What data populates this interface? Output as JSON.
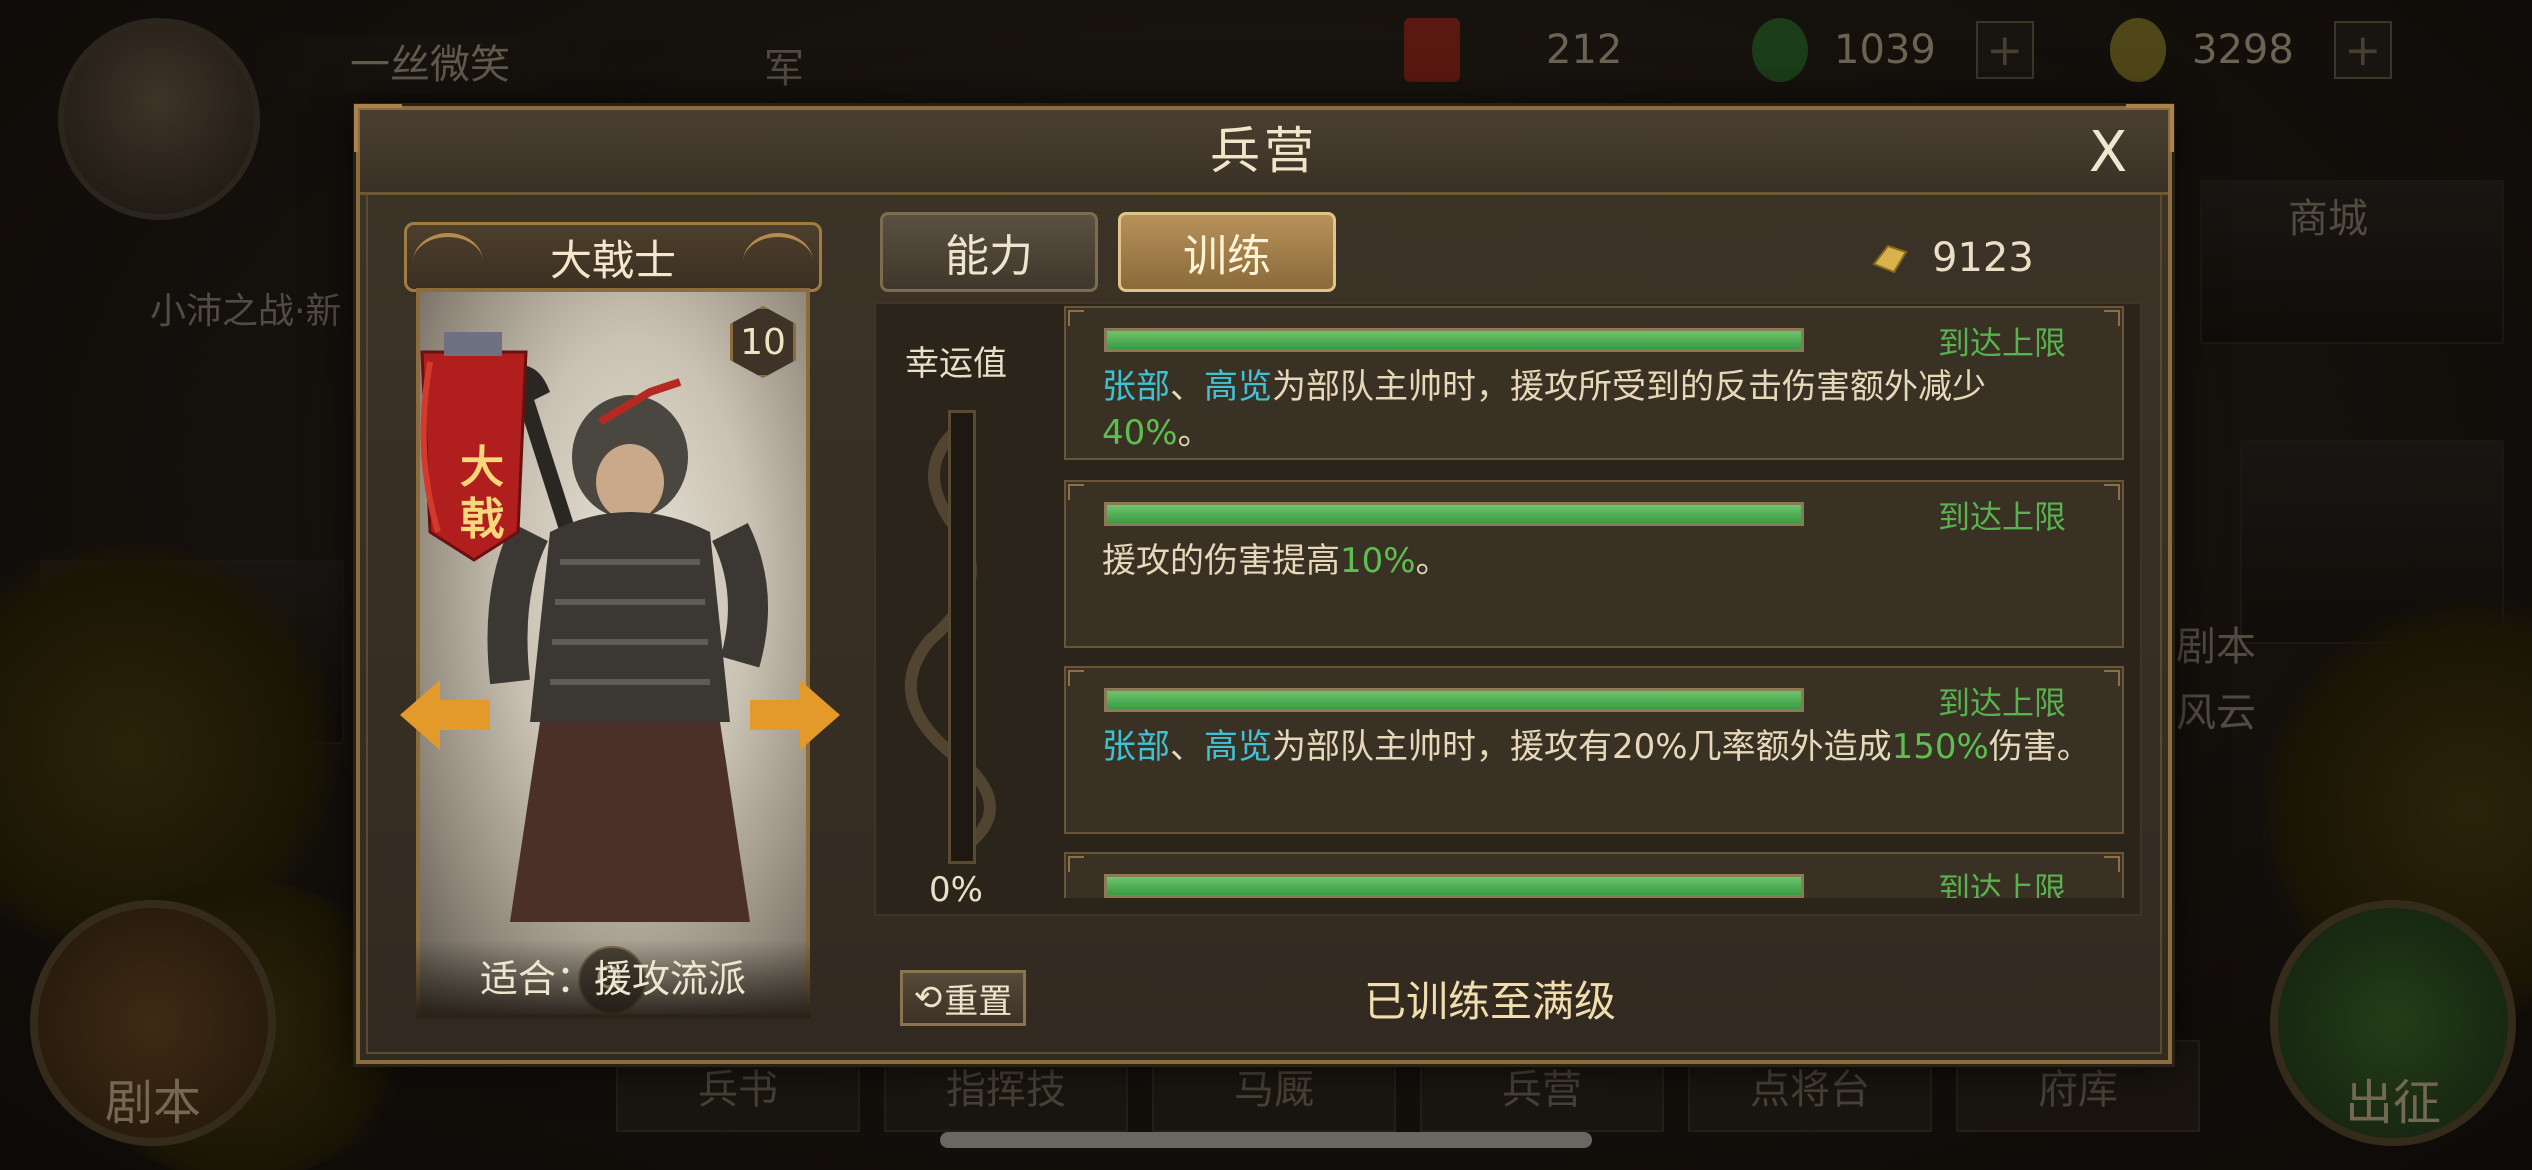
{
  "background": {
    "player_name": "一丝微笑",
    "side_text_1": "军",
    "side_text_2": "小沛之战·新",
    "right_labels": [
      "商城",
      "剧本",
      "风云"
    ],
    "left_round_button": "剧本",
    "right_round_button": "出征",
    "bottom_tabs": [
      "兵书",
      "指挥技",
      "马厩",
      "兵营",
      "点将台",
      "府库"
    ],
    "resources": [
      {
        "icon": "red-token-icon",
        "value": "212"
      },
      {
        "icon": "jade-icon",
        "value": "1039",
        "plus": "+"
      },
      {
        "icon": "gold-ingot-icon",
        "value": "3298",
        "plus": "+"
      }
    ]
  },
  "modal": {
    "title": "兵营",
    "close_label": "X",
    "hero": {
      "name": "大戟士",
      "level": "10",
      "banner_text": [
        "大",
        "戟"
      ],
      "suitable": "适合：援攻流派"
    },
    "tabs": [
      {
        "label": "能力",
        "active": false
      },
      {
        "label": "训练",
        "active": true
      }
    ],
    "gold": "9123",
    "luck": {
      "label": "幸运值",
      "value": "0%",
      "fill_fraction": 0
    },
    "training": [
      {
        "progress_fraction": 1.0,
        "status": "到达上限",
        "desc_parts": [
          {
            "t": "张部",
            "c": "blue"
          },
          {
            "t": "、",
            "c": ""
          },
          {
            "t": "高览",
            "c": "blue"
          },
          {
            "t": "为部队主帅时，援攻所受到的反击伤害额外减少",
            "c": ""
          },
          {
            "t": "40%",
            "c": "green"
          },
          {
            "t": "。",
            "c": ""
          }
        ]
      },
      {
        "progress_fraction": 1.0,
        "status": "到达上限",
        "desc_parts": [
          {
            "t": "援攻的伤害提高",
            "c": ""
          },
          {
            "t": "10%",
            "c": "green"
          },
          {
            "t": "。",
            "c": ""
          }
        ]
      },
      {
        "progress_fraction": 1.0,
        "status": "到达上限",
        "desc_parts": [
          {
            "t": "张部",
            "c": "blue"
          },
          {
            "t": "、",
            "c": ""
          },
          {
            "t": "高览",
            "c": "blue"
          },
          {
            "t": "为部队主帅时，援攻有20%几率额外造成",
            "c": ""
          },
          {
            "t": "150%",
            "c": "green"
          },
          {
            "t": "伤害。",
            "c": ""
          }
        ]
      },
      {
        "progress_fraction": 1.0,
        "status": "到达上限",
        "desc_parts": []
      }
    ],
    "reset_label": "重置",
    "status_text": "已训练至满级"
  },
  "colors": {
    "accent_gold": "#b8915a",
    "highlight_blue": "#3fc1d6",
    "highlight_green": "#5cbf4f",
    "progress_green": "#4fb052"
  }
}
